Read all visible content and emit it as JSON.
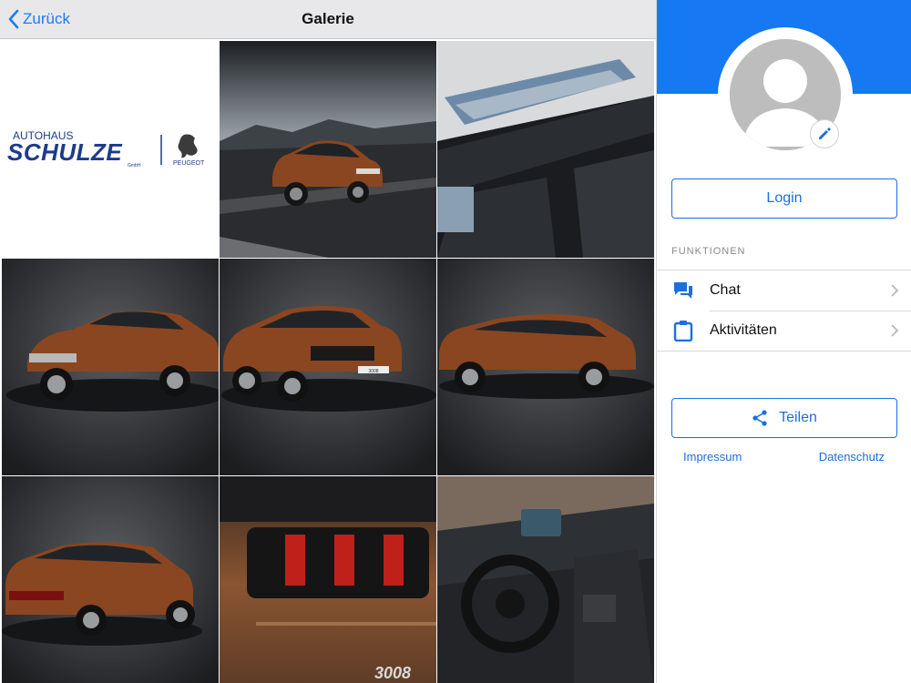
{
  "navbar": {
    "back_label": "Zurück",
    "title": "Galerie"
  },
  "gallery": {
    "logo": {
      "top_line": "AUTOHAUS",
      "name": "SCHULZE",
      "suffix": "GmbH",
      "brand": "PEUGEOT"
    },
    "badges": {
      "tail_model": "3008",
      "plate": "3008"
    }
  },
  "panel": {
    "login_label": "Login",
    "section_label": "FUNKTIONEN",
    "items": [
      {
        "label": "Chat",
        "icon": "chat-icon"
      },
      {
        "label": "Aktivitäten",
        "icon": "clipboard-icon"
      }
    ],
    "share_label": "Teilen",
    "impressum_label": "Impressum",
    "datenschutz_label": "Datenschutz"
  },
  "colors": {
    "accent": "#1678f2",
    "link": "#1a6fe0",
    "car_copper": "#8a4620"
  }
}
